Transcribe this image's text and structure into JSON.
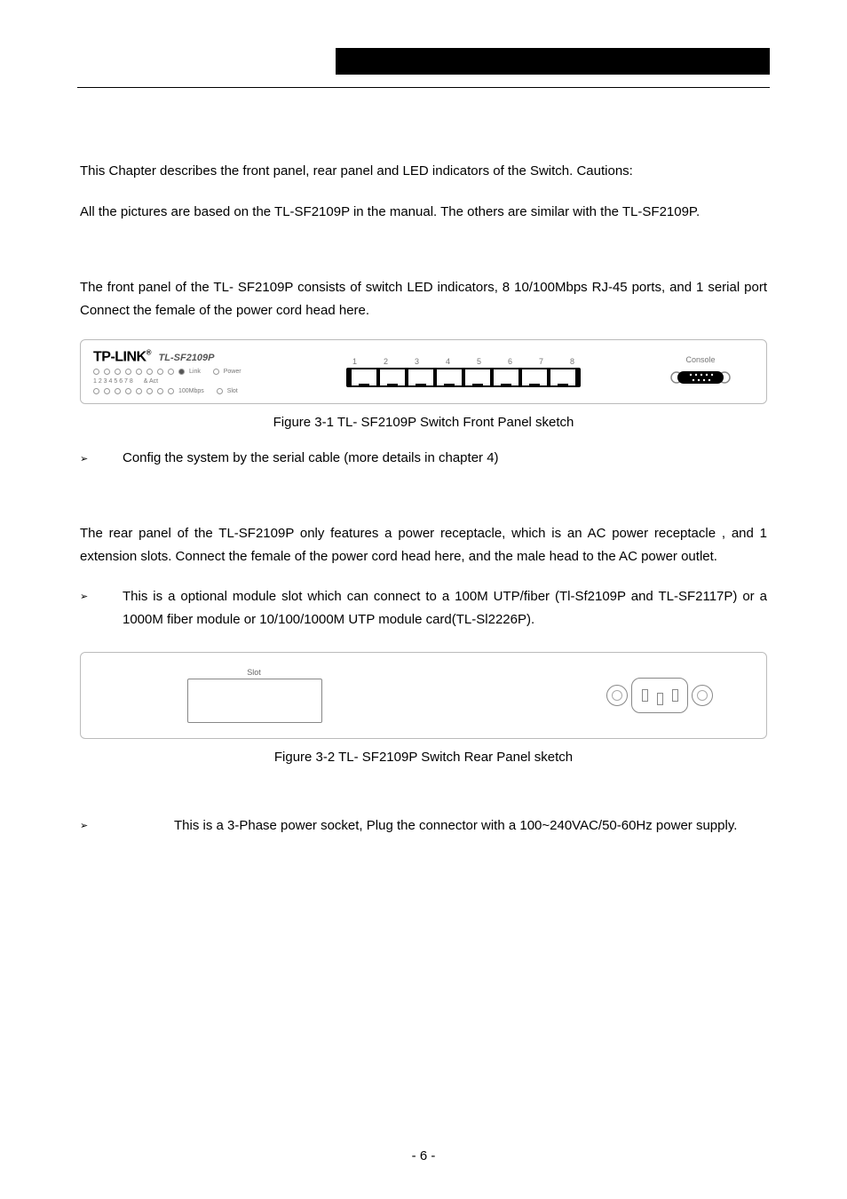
{
  "intro": {
    "p1": "This Chapter describes the front panel, rear panel and LED indicators of the Switch. Cautions:",
    "p2": "All the pictures are based on the TL-SF2109P in the manual. The others are similar with the TL-SF2109P."
  },
  "front": {
    "desc": "The front panel of the TL- SF2109P consists of switch LED indicators, 8 10/100Mbps RJ-45 ports, and 1 serial port Connect the female of the power cord head here.",
    "logo_brand": "TP-LINK",
    "logo_reg": "®",
    "logo_model": "TL-SF2109P",
    "led_link": "Link",
    "led_act": "& Act",
    "led_power": "Power",
    "led_100m": "100Mbps",
    "led_slot": "Slot",
    "nums_prefix": "1 2 3 4 5 6 7 8",
    "port_nums": [
      "1",
      "2",
      "3",
      "4",
      "5",
      "6",
      "7",
      "8"
    ],
    "console_label": "Console",
    "caption": "Figure 3-1 TL- SF2109P Switch Front Panel sketch",
    "bullet": "Config the system by the serial cable (more details in chapter 4)"
  },
  "rear": {
    "desc": "The rear panel of the TL-SF2109P only features a power receptacle, which is an AC power receptacle , and 1 extension slots. Connect the female of the power cord head here, and the male head to the AC power outlet.",
    "bullet_slot": "This is a optional module slot which can connect to a 100M UTP/fiber (Tl-Sf2109P and TL-SF2117P) or a 1000M fiber module or 10/100/1000M UTP module card(TL-Sl2226P).",
    "slot_label": "Slot",
    "caption": "Figure 3-2 TL- SF2109P Switch Rear Panel sketch",
    "bullet_power": "This is a 3-Phase power socket, Plug the connector with a 100~240VAC/50-60Hz power supply."
  },
  "footer": "- 6 -",
  "glyphs": {
    "tri": "➢"
  }
}
